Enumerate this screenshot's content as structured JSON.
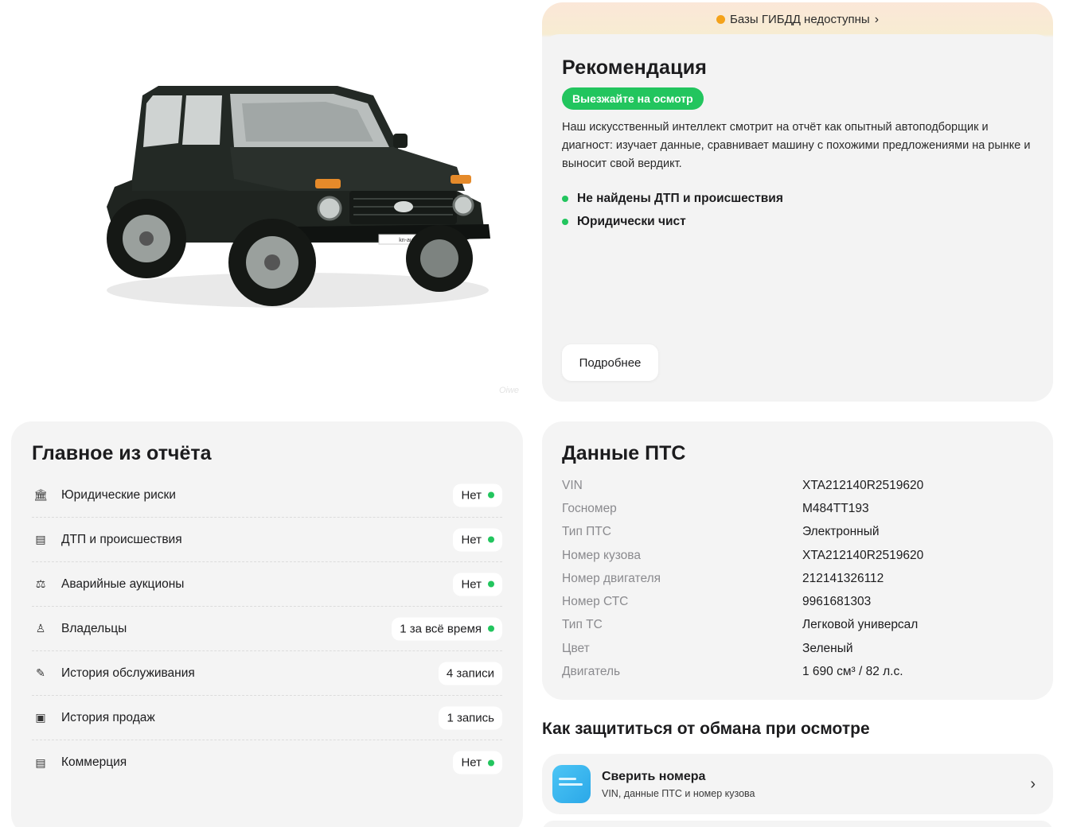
{
  "photo": {
    "plate_text": "kn-auto.ru",
    "watermark": "Oiwe"
  },
  "recommendation": {
    "banner": "Базы ГИБДД недоступны",
    "title": "Рекомендация",
    "pill": "Выезжайте на осмотр",
    "description": "Наш искусственный интеллект смотрит на отчёт как опытный автоподборщик и диагност: изучает данные, сравнивает машину с похожими предложениями на рынке и выносит свой вердикт.",
    "points": [
      "Не найдены ДТП и происшествия",
      "Юридически чист"
    ],
    "more_button": "Подробнее"
  },
  "summary": {
    "title": "Главное из отчёта",
    "rows": [
      {
        "label": "Юридические риски",
        "value": "Нет",
        "status": "ok",
        "icon": "bank-icon"
      },
      {
        "label": "ДТП и происшествия",
        "value": "Нет",
        "status": "ok",
        "icon": "document-icon"
      },
      {
        "label": "Аварийные аукционы",
        "value": "Нет",
        "status": "ok",
        "icon": "gavel-icon"
      },
      {
        "label": "Владельцы",
        "value": "1 за всё время",
        "status": "ok",
        "icon": "person-icon"
      },
      {
        "label": "История обслуживания",
        "value": "4 записи",
        "status": "",
        "icon": "wrench-icon"
      },
      {
        "label": "История продаж",
        "value": "1 запись",
        "status": "",
        "icon": "receipt-icon"
      },
      {
        "label": "Коммерция",
        "value": "Нет",
        "status": "ok",
        "icon": "document-icon"
      }
    ]
  },
  "pts": {
    "title": "Данные ПТС",
    "rows": [
      {
        "key": "VIN",
        "value": "XTA212140R2519620"
      },
      {
        "key": "Госномер",
        "value": "М484ТТ193"
      },
      {
        "key": "Тип ПТС",
        "value": "Электронный"
      },
      {
        "key": "Номер кузова",
        "value": "XTA212140R2519620"
      },
      {
        "key": "Номер двигателя",
        "value": "212141326112"
      },
      {
        "key": "Номер СТС",
        "value": "9961681303"
      },
      {
        "key": "Тип ТС",
        "value": "Легковой универсал"
      },
      {
        "key": "Цвет",
        "value": "Зеленый"
      },
      {
        "key": "Двигатель",
        "value": "1 690 см³ / 82 л.с."
      }
    ]
  },
  "protect": {
    "title": "Как защититься от обмана при осмотре",
    "tips": [
      {
        "title": "Сверить номера",
        "subtitle": "VIN, данные ПТС и номер кузова"
      }
    ]
  },
  "colors": {
    "accent_green": "#22c55e",
    "warning_orange": "#f4a21a",
    "card_bg": "#f4f4f4"
  }
}
